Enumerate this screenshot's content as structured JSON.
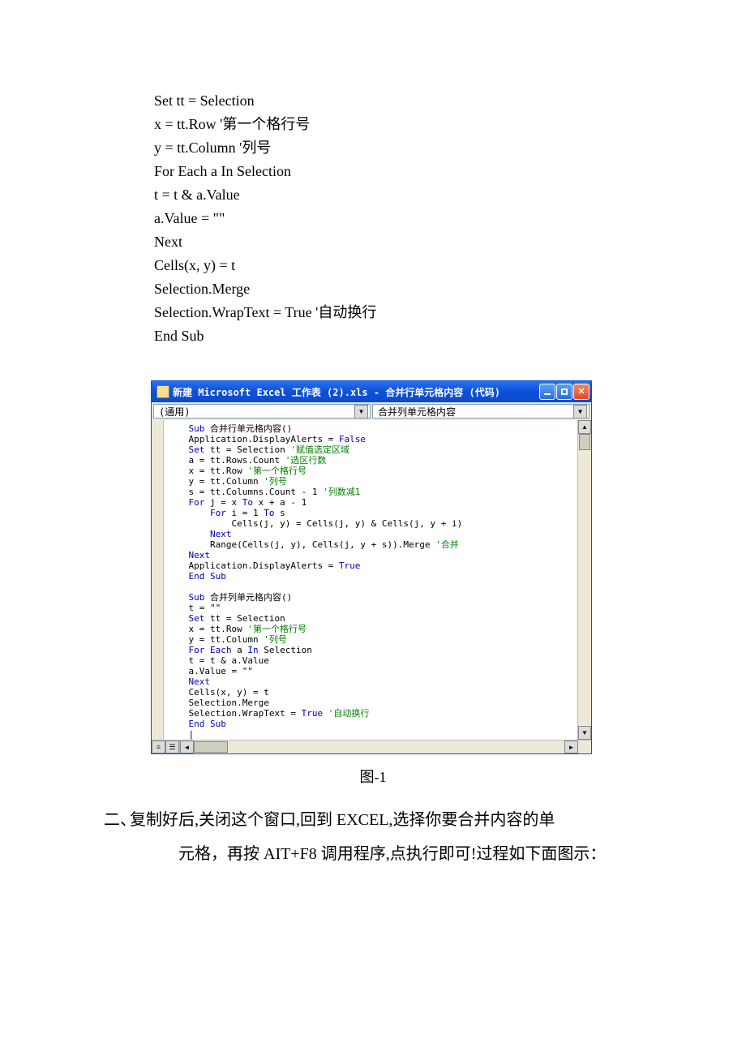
{
  "code_lines": [
    "Set tt = Selection",
    "x = tt.Row '第一个格行号",
    "y = tt.Column '列号",
    "For Each a In Selection",
    "t = t & a.Value",
    "a.Value = \"\"",
    "Next",
    "Cells(x, y) = t",
    "Selection.Merge",
    "Selection.WrapText = True '自动换行",
    "End Sub"
  ],
  "vbe": {
    "title": "新建 Microsoft Excel 工作表 (2).xls - 合并行单元格内容 (代码)",
    "dropdown_left": "(通用)",
    "dropdown_right": "合并列单元格内容",
    "icon_name": "vbe-module-icon"
  },
  "vbe_code_tokens": [
    [
      [
        "kw",
        "Sub"
      ],
      [
        "",
        " 合并行单元格内容()"
      ]
    ],
    [
      [
        "",
        "Application.DisplayAlerts = "
      ],
      [
        "kw",
        "False"
      ]
    ],
    [
      [
        "kw",
        "Set"
      ],
      [
        "",
        " tt = Selection "
      ],
      [
        "cm",
        "'赋值选定区域"
      ]
    ],
    [
      [
        "",
        "a = tt.Rows.Count "
      ],
      [
        "cm",
        "'选区行数"
      ]
    ],
    [
      [
        "",
        "x = tt.Row "
      ],
      [
        "cm",
        "'第一个格行号"
      ]
    ],
    [
      [
        "",
        "y = tt.Column "
      ],
      [
        "cm",
        "'列号"
      ]
    ],
    [
      [
        "",
        "s = tt.Columns.Count - 1 "
      ],
      [
        "cm",
        "'列数减1"
      ]
    ],
    [
      [
        "kw",
        "For"
      ],
      [
        "",
        " j = x "
      ],
      [
        "kw",
        "To"
      ],
      [
        "",
        " x + a - 1"
      ]
    ],
    [
      [
        "",
        "    "
      ],
      [
        "kw",
        "For"
      ],
      [
        "",
        " i = 1 "
      ],
      [
        "kw",
        "To"
      ],
      [
        "",
        " s"
      ]
    ],
    [
      [
        "",
        "        Cells(j, y) = Cells(j, y) & Cells(j, y + i)"
      ]
    ],
    [
      [
        "",
        "    "
      ],
      [
        "kw",
        "Next"
      ]
    ],
    [
      [
        "",
        "    Range(Cells(j, y), Cells(j, y + s)).Merge "
      ],
      [
        "cm",
        "'合并"
      ]
    ],
    [
      [
        "kw",
        "Next"
      ]
    ],
    [
      [
        "",
        "Application.DisplayAlerts = "
      ],
      [
        "kw",
        "True"
      ]
    ],
    [
      [
        "kw",
        "End Sub"
      ]
    ],
    [
      [
        "",
        ""
      ]
    ],
    [
      [
        "kw",
        "Sub"
      ],
      [
        "",
        " 合并列单元格内容()"
      ]
    ],
    [
      [
        "",
        "t = \"\""
      ]
    ],
    [
      [
        "kw",
        "Set"
      ],
      [
        "",
        " tt = Selection"
      ]
    ],
    [
      [
        "",
        "x = tt.Row "
      ],
      [
        "cm",
        "'第一个格行号"
      ]
    ],
    [
      [
        "",
        "y = tt.Column "
      ],
      [
        "cm",
        "'列号"
      ]
    ],
    [
      [
        "kw",
        "For Each"
      ],
      [
        "",
        " a "
      ],
      [
        "kw",
        "In"
      ],
      [
        "",
        " Selection"
      ]
    ],
    [
      [
        "",
        "t = t & a.Value"
      ]
    ],
    [
      [
        "",
        "a.Value = \"\""
      ]
    ],
    [
      [
        "kw",
        "Next"
      ]
    ],
    [
      [
        "",
        "Cells(x, y) = t"
      ]
    ],
    [
      [
        "",
        "Selection.Merge"
      ]
    ],
    [
      [
        "",
        "Selection.WrapText = "
      ],
      [
        "kw",
        "True"
      ],
      [
        "",
        " "
      ],
      [
        "cm",
        "'自动换行"
      ]
    ],
    [
      [
        "kw",
        "End Sub"
      ]
    ],
    [
      [
        "",
        "|"
      ]
    ]
  ],
  "caption": "图-1",
  "list_marker": "二、",
  "body_line1": "复制好后,关闭这个窗口,回到 EXCEL,选择你要合并内容的单",
  "body_line2": "元格，再按 AIT+F8 调用程序,点执行即可!过程如下面图示："
}
